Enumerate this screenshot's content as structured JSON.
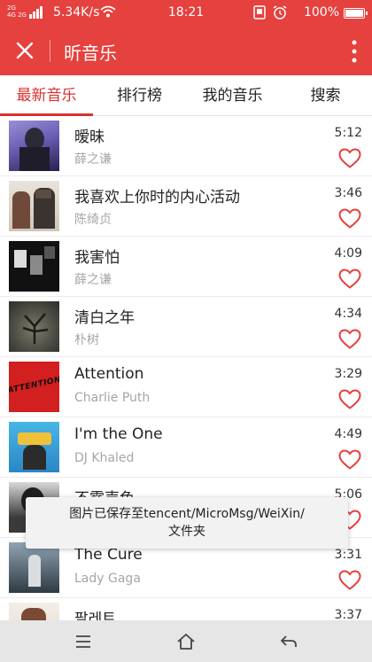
{
  "status_bar": {
    "sig_top": "2G",
    "sig_bottom": "4G 2G",
    "speed": "5.34K/s",
    "time": "18:21",
    "battery": "100%"
  },
  "title_bar": {
    "title": "昕音乐"
  },
  "tabs": [
    {
      "label": "最新音乐",
      "active": true
    },
    {
      "label": "排行榜",
      "active": false
    },
    {
      "label": "我的音乐",
      "active": false
    },
    {
      "label": "搜索",
      "active": false
    }
  ],
  "songs": [
    {
      "title": "暧昧",
      "artist": "薛之谦",
      "duration": "5:12"
    },
    {
      "title": "我喜欢上你时的内心活动",
      "artist": "陈绮贞",
      "duration": "3:46"
    },
    {
      "title": "我害怕",
      "artist": "薛之谦",
      "duration": "4:09"
    },
    {
      "title": "清白之年",
      "artist": "朴树",
      "duration": "4:34"
    },
    {
      "title": "Attention",
      "artist": "Charlie Puth",
      "duration": "3:29"
    },
    {
      "title": "I'm the One",
      "artist": "DJ Khaled",
      "duration": "4:49"
    },
    {
      "title": "不露声色",
      "artist": "",
      "duration": "5:06"
    },
    {
      "title": "The Cure",
      "artist": "Lady Gaga",
      "duration": "3:31"
    },
    {
      "title": "팔레트",
      "artist": "",
      "duration": "3:37"
    }
  ],
  "cover_art": {
    "attention_text": "ATTENTION"
  },
  "toast": {
    "line1": "图片已保存至tencent/MicroMsg/WeiXin/",
    "line2": "文件夹"
  },
  "colors": {
    "brand": "#e5413e",
    "accent": "#d9322f",
    "heart": "#e5413e"
  }
}
